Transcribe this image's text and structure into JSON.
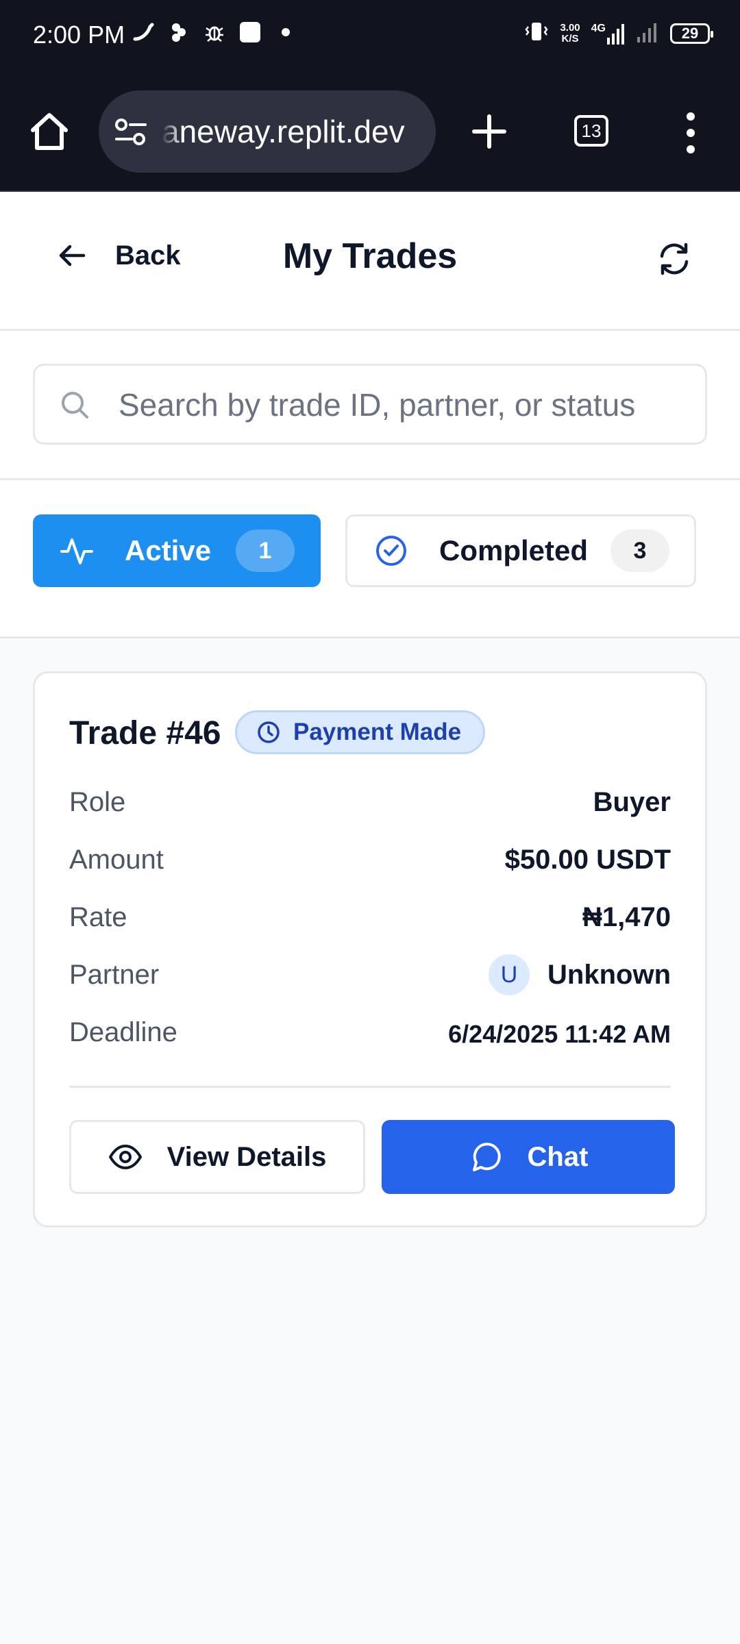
{
  "status_bar": {
    "time": "2:00 PM",
    "net_speed": "3.00",
    "net_unit": "K/S",
    "network_type": "4G",
    "battery": "29"
  },
  "browser": {
    "url": "aneway.replit.dev",
    "tab_count": "13"
  },
  "header": {
    "back_label": "Back",
    "title": "My Trades"
  },
  "search": {
    "placeholder": "Search by trade ID, partner, or status"
  },
  "tabs": [
    {
      "label": "Active",
      "count": "1",
      "active": true
    },
    {
      "label": "Completed",
      "count": "3",
      "active": false
    }
  ],
  "trade": {
    "title": "Trade #46",
    "status": "Payment Made",
    "rows": {
      "role": {
        "label": "Role",
        "value": "Buyer"
      },
      "amount": {
        "label": "Amount",
        "value": "$50.00 USDT"
      },
      "rate": {
        "label": "Rate",
        "value": "₦1,470"
      },
      "partner": {
        "label": "Partner",
        "avatar": "U",
        "value": "Unknown"
      },
      "deadline": {
        "label": "Deadline",
        "value": "6/24/2025 11:42 AM"
      }
    },
    "actions": {
      "details_label": "View Details",
      "chat_label": "Chat"
    }
  },
  "colors": {
    "status_bar_bg": "#11141f",
    "active_tab": "#1d8ff0",
    "chat_button": "#2563eb",
    "badge_bg": "#dbeafe",
    "badge_text": "#1e40af"
  }
}
